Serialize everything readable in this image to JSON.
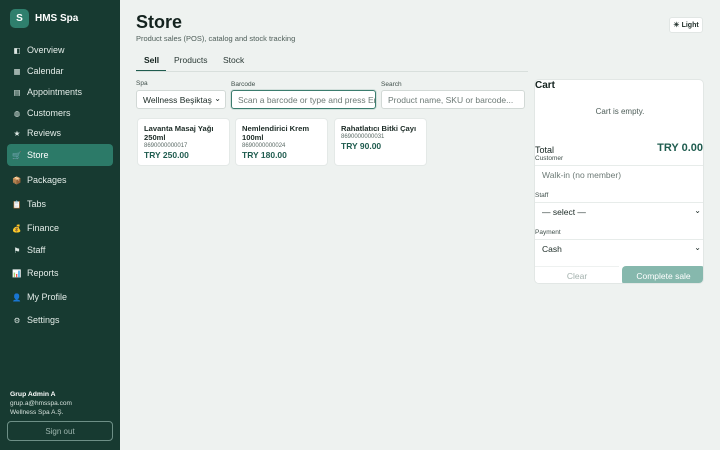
{
  "app": {
    "logo_letter": "S",
    "name": "HMS Spa"
  },
  "nav": [
    {
      "label": "Overview",
      "icon": "◧",
      "icon_name": "overview-icon"
    },
    {
      "label": "Calendar",
      "icon": "▦",
      "icon_name": "calendar-icon"
    },
    {
      "label": "Appointments",
      "icon": "▤",
      "icon_name": "appointments-icon"
    },
    {
      "label": "Customers",
      "icon": "◍",
      "icon_name": "customers-icon"
    },
    {
      "label": "Reviews",
      "icon": "★",
      "icon_name": "star-icon"
    },
    {
      "label": "Store",
      "icon": "🛒",
      "icon_name": "cart-icon"
    },
    {
      "label": "Packages",
      "icon": "📦",
      "icon_name": "package-icon"
    },
    {
      "label": "Tabs",
      "icon": "📋",
      "icon_name": "clipboard-icon"
    },
    {
      "label": "Finance",
      "icon": "💰",
      "icon_name": "money-bag-icon"
    },
    {
      "label": "Staff",
      "icon": "⚑",
      "icon_name": "staff-icon"
    },
    {
      "label": "Reports",
      "icon": "📊",
      "icon_name": "reports-icon"
    },
    {
      "label": "My Profile",
      "icon": "👤",
      "icon_name": "profile-icon"
    },
    {
      "label": "Settings",
      "icon": "⚙",
      "icon_name": "gear-icon"
    }
  ],
  "nav_active": "Store",
  "user": {
    "name": "Grup Admin A",
    "email": "grup.a@hmsspa.com",
    "org": "Wellness Spa A.Ş.",
    "signout": "Sign out"
  },
  "page": {
    "title": "Store",
    "subtitle": "Product sales (POS), catalog and stock tracking",
    "theme_label": "Light",
    "theme_icon": "☀"
  },
  "tabs": [
    {
      "label": "Sell"
    },
    {
      "label": "Products"
    },
    {
      "label": "Stock"
    }
  ],
  "tabs_active": "Sell",
  "filters": {
    "spa_label": "Spa",
    "spa_value": "Wellness Beşiktaş",
    "barcode_label": "Barcode",
    "barcode_placeholder": "Scan a barcode or type and press Enter",
    "search_label": "Search",
    "search_placeholder": "Product name, SKU or barcode..."
  },
  "products": [
    {
      "name": "Lavanta Masaj Yağı 250ml",
      "sku": "8690000000017",
      "price": "TRY 250.00"
    },
    {
      "name": "Nemlendirici Krem 100ml",
      "sku": "8690000000024",
      "price": "TRY 180.00"
    },
    {
      "name": "Rahatlatıcı Bitki Çayı",
      "sku": "8690000000031",
      "price": "TRY 90.00"
    }
  ],
  "cart": {
    "title": "Cart",
    "empty_text": "Cart is empty.",
    "total_label": "Total",
    "total_value": "TRY 0.00",
    "customer_label": "Customer",
    "customer_placeholder": "Walk-in (no member)",
    "staff_label": "Staff",
    "staff_value": "— select —",
    "payment_label": "Payment",
    "payment_value": "Cash",
    "clear_label": "Clear",
    "complete_label": "Complete sale"
  },
  "colors": {
    "sidebar": "#173a31",
    "accent": "#2c7a68",
    "price": "#1f5c4f",
    "complete_button": "#86b8ad"
  }
}
